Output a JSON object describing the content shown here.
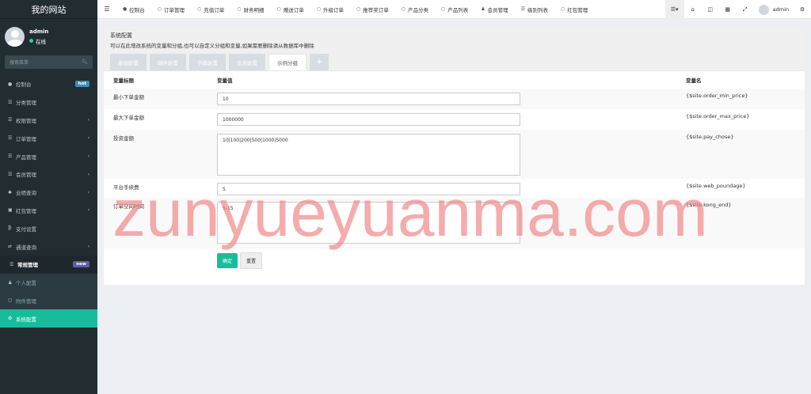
{
  "sidebar": {
    "logo": "我的网站",
    "user": {
      "name": "admin",
      "status": "在线"
    },
    "search_placeholder": "搜索菜单",
    "items": [
      {
        "label": "控制台",
        "icon": "dashboard-icon",
        "badge": "hot"
      },
      {
        "label": "分类管理",
        "icon": "list-icon"
      },
      {
        "label": "权限管理",
        "icon": "list-icon"
      },
      {
        "label": "订单管理",
        "icon": "list-icon"
      },
      {
        "label": "产品管理",
        "icon": "list-icon"
      },
      {
        "label": "会员管理",
        "icon": "list-icon"
      },
      {
        "label": "业绩查询",
        "icon": "asterisk-icon"
      },
      {
        "label": "红包管理",
        "icon": "gift-icon"
      },
      {
        "label": "支付设置",
        "icon": "bitcoin-icon"
      },
      {
        "label": "通道查询",
        "icon": "exchange-icon"
      },
      {
        "label": "常规管理",
        "icon": "list-icon",
        "badge": "new"
      },
      {
        "label": "个人配置",
        "icon": "user-icon"
      },
      {
        "label": "附件管理",
        "icon": "circle-icon"
      },
      {
        "label": "系统配置",
        "icon": "gears-icon"
      }
    ]
  },
  "topbar": {
    "tabs": [
      {
        "label": "控制台",
        "icon": "dashboard-icon"
      },
      {
        "label": "订单管理",
        "icon": "circle-icon"
      },
      {
        "label": "充值订单",
        "icon": "circle-icon"
      },
      {
        "label": "财务明细",
        "icon": "circle-icon"
      },
      {
        "label": "赠送订单",
        "icon": "circle-icon"
      },
      {
        "label": "升级订单",
        "icon": "circle-icon"
      },
      {
        "label": "推荐奖订单",
        "icon": "circle-icon"
      },
      {
        "label": "产品分类",
        "icon": "circle-icon"
      },
      {
        "label": "产品列表",
        "icon": "circle-icon"
      },
      {
        "label": "会员管理",
        "icon": "user-icon"
      },
      {
        "label": "级别列表",
        "icon": "list-icon"
      },
      {
        "label": "红包管理",
        "icon": "circle-icon"
      }
    ],
    "username": "admin"
  },
  "panel": {
    "title": "系统配置",
    "desc": "可以在此增改系统的变量和分组,也可以自定义分组和变量,如果需要删除请从数据库中删除",
    "tabs": [
      "基础配置",
      "邮件配置",
      "字典配置",
      "会员配置",
      "示例分组",
      "+"
    ],
    "headers": {
      "title": "变量标题",
      "value": "变量值",
      "name": "变量名"
    },
    "rows": [
      {
        "title": "最小下单金额",
        "value": "10",
        "name": "{$site.order_min_price}"
      },
      {
        "title": "最大下单金额",
        "value": "1000000",
        "name": "{$site.order_max_price}"
      },
      {
        "title": "投资金额",
        "value": "10|100|200|500|1000|5000",
        "name": "{$site.pay_chose}"
      },
      {
        "title": "平台手续费",
        "value": "5",
        "name": "{$site.web_poundage}"
      },
      {
        "title": "订单空间时间",
        "value": "5-15",
        "name": "{$site.kong_end}"
      }
    ],
    "btn_ok": "确定",
    "btn_reset": "重置"
  },
  "watermark": "zunyueyuanma.com"
}
